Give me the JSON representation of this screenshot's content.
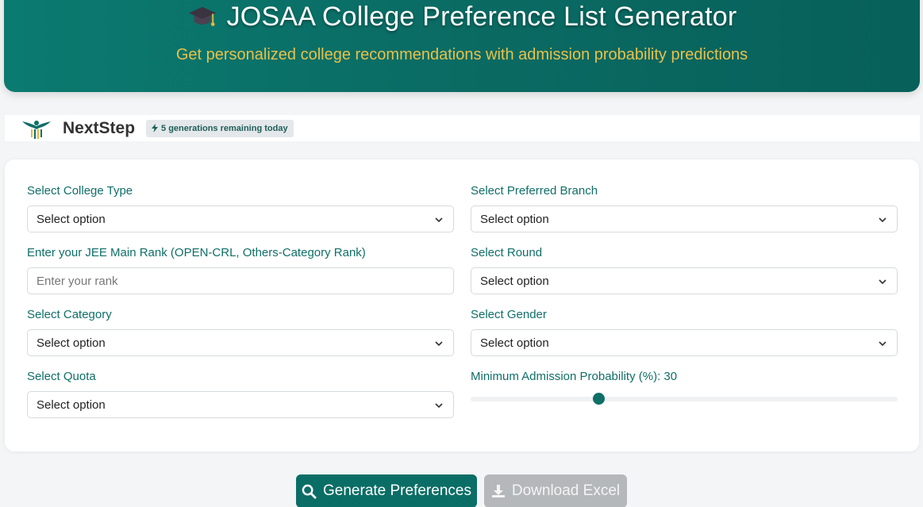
{
  "header": {
    "title": "JOSAA College Preference List Generator",
    "subtitle": "Get personalized college recommendations with admission probability predictions"
  },
  "brand": {
    "name": "NextStep",
    "badge": "5 generations remaining today"
  },
  "form": {
    "college_type": {
      "label": "Select College Type",
      "value": "Select option"
    },
    "branch": {
      "label": "Select Preferred Branch",
      "value": "Select option"
    },
    "rank": {
      "label": "Enter your JEE Main Rank (OPEN-CRL, Others-Category Rank)",
      "placeholder": "Enter your rank"
    },
    "round": {
      "label": "Select Round",
      "value": "Select option"
    },
    "category": {
      "label": "Select Category",
      "value": "Select option"
    },
    "gender": {
      "label": "Select Gender",
      "value": "Select option"
    },
    "quota": {
      "label": "Select Quota",
      "value": "Select option"
    },
    "probability": {
      "label": "Minimum Admission Probability (%): 30",
      "value": 30,
      "min": 0,
      "max": 100
    }
  },
  "actions": {
    "generate": "Generate Preferences",
    "download": "Download Excel"
  },
  "colors": {
    "primary": "#0b6e66",
    "accent": "#e8c14a",
    "label": "#0f6f68"
  }
}
